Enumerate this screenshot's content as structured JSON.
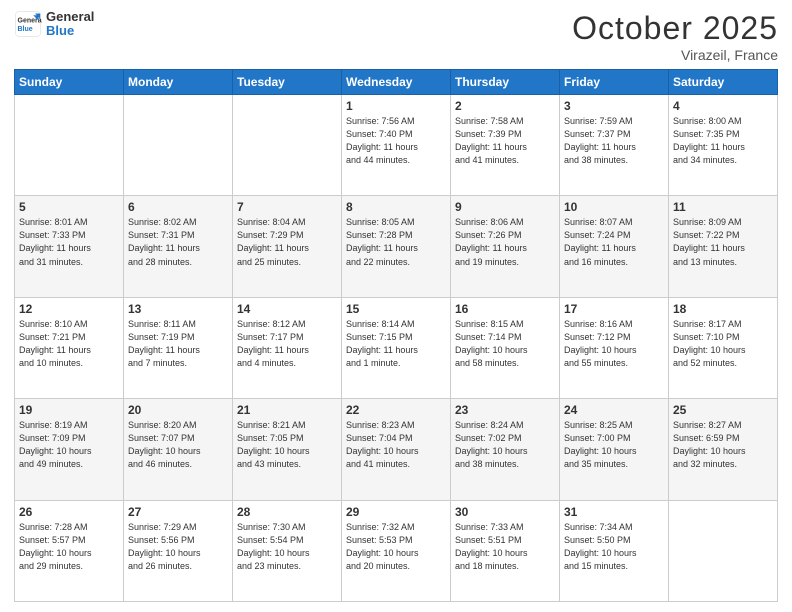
{
  "header": {
    "logo_line1": "General",
    "logo_line2": "Blue",
    "month": "October 2025",
    "location": "Virazeil, France"
  },
  "weekdays": [
    "Sunday",
    "Monday",
    "Tuesday",
    "Wednesday",
    "Thursday",
    "Friday",
    "Saturday"
  ],
  "weeks": [
    [
      {
        "day": "",
        "info": ""
      },
      {
        "day": "",
        "info": ""
      },
      {
        "day": "",
        "info": ""
      },
      {
        "day": "1",
        "info": "Sunrise: 7:56 AM\nSunset: 7:40 PM\nDaylight: 11 hours\nand 44 minutes."
      },
      {
        "day": "2",
        "info": "Sunrise: 7:58 AM\nSunset: 7:39 PM\nDaylight: 11 hours\nand 41 minutes."
      },
      {
        "day": "3",
        "info": "Sunrise: 7:59 AM\nSunset: 7:37 PM\nDaylight: 11 hours\nand 38 minutes."
      },
      {
        "day": "4",
        "info": "Sunrise: 8:00 AM\nSunset: 7:35 PM\nDaylight: 11 hours\nand 34 minutes."
      }
    ],
    [
      {
        "day": "5",
        "info": "Sunrise: 8:01 AM\nSunset: 7:33 PM\nDaylight: 11 hours\nand 31 minutes."
      },
      {
        "day": "6",
        "info": "Sunrise: 8:02 AM\nSunset: 7:31 PM\nDaylight: 11 hours\nand 28 minutes."
      },
      {
        "day": "7",
        "info": "Sunrise: 8:04 AM\nSunset: 7:29 PM\nDaylight: 11 hours\nand 25 minutes."
      },
      {
        "day": "8",
        "info": "Sunrise: 8:05 AM\nSunset: 7:28 PM\nDaylight: 11 hours\nand 22 minutes."
      },
      {
        "day": "9",
        "info": "Sunrise: 8:06 AM\nSunset: 7:26 PM\nDaylight: 11 hours\nand 19 minutes."
      },
      {
        "day": "10",
        "info": "Sunrise: 8:07 AM\nSunset: 7:24 PM\nDaylight: 11 hours\nand 16 minutes."
      },
      {
        "day": "11",
        "info": "Sunrise: 8:09 AM\nSunset: 7:22 PM\nDaylight: 11 hours\nand 13 minutes."
      }
    ],
    [
      {
        "day": "12",
        "info": "Sunrise: 8:10 AM\nSunset: 7:21 PM\nDaylight: 11 hours\nand 10 minutes."
      },
      {
        "day": "13",
        "info": "Sunrise: 8:11 AM\nSunset: 7:19 PM\nDaylight: 11 hours\nand 7 minutes."
      },
      {
        "day": "14",
        "info": "Sunrise: 8:12 AM\nSunset: 7:17 PM\nDaylight: 11 hours\nand 4 minutes."
      },
      {
        "day": "15",
        "info": "Sunrise: 8:14 AM\nSunset: 7:15 PM\nDaylight: 11 hours\nand 1 minute."
      },
      {
        "day": "16",
        "info": "Sunrise: 8:15 AM\nSunset: 7:14 PM\nDaylight: 10 hours\nand 58 minutes."
      },
      {
        "day": "17",
        "info": "Sunrise: 8:16 AM\nSunset: 7:12 PM\nDaylight: 10 hours\nand 55 minutes."
      },
      {
        "day": "18",
        "info": "Sunrise: 8:17 AM\nSunset: 7:10 PM\nDaylight: 10 hours\nand 52 minutes."
      }
    ],
    [
      {
        "day": "19",
        "info": "Sunrise: 8:19 AM\nSunset: 7:09 PM\nDaylight: 10 hours\nand 49 minutes."
      },
      {
        "day": "20",
        "info": "Sunrise: 8:20 AM\nSunset: 7:07 PM\nDaylight: 10 hours\nand 46 minutes."
      },
      {
        "day": "21",
        "info": "Sunrise: 8:21 AM\nSunset: 7:05 PM\nDaylight: 10 hours\nand 43 minutes."
      },
      {
        "day": "22",
        "info": "Sunrise: 8:23 AM\nSunset: 7:04 PM\nDaylight: 10 hours\nand 41 minutes."
      },
      {
        "day": "23",
        "info": "Sunrise: 8:24 AM\nSunset: 7:02 PM\nDaylight: 10 hours\nand 38 minutes."
      },
      {
        "day": "24",
        "info": "Sunrise: 8:25 AM\nSunset: 7:00 PM\nDaylight: 10 hours\nand 35 minutes."
      },
      {
        "day": "25",
        "info": "Sunrise: 8:27 AM\nSunset: 6:59 PM\nDaylight: 10 hours\nand 32 minutes."
      }
    ],
    [
      {
        "day": "26",
        "info": "Sunrise: 7:28 AM\nSunset: 5:57 PM\nDaylight: 10 hours\nand 29 minutes."
      },
      {
        "day": "27",
        "info": "Sunrise: 7:29 AM\nSunset: 5:56 PM\nDaylight: 10 hours\nand 26 minutes."
      },
      {
        "day": "28",
        "info": "Sunrise: 7:30 AM\nSunset: 5:54 PM\nDaylight: 10 hours\nand 23 minutes."
      },
      {
        "day": "29",
        "info": "Sunrise: 7:32 AM\nSunset: 5:53 PM\nDaylight: 10 hours\nand 20 minutes."
      },
      {
        "day": "30",
        "info": "Sunrise: 7:33 AM\nSunset: 5:51 PM\nDaylight: 10 hours\nand 18 minutes."
      },
      {
        "day": "31",
        "info": "Sunrise: 7:34 AM\nSunset: 5:50 PM\nDaylight: 10 hours\nand 15 minutes."
      },
      {
        "day": "",
        "info": ""
      }
    ]
  ]
}
